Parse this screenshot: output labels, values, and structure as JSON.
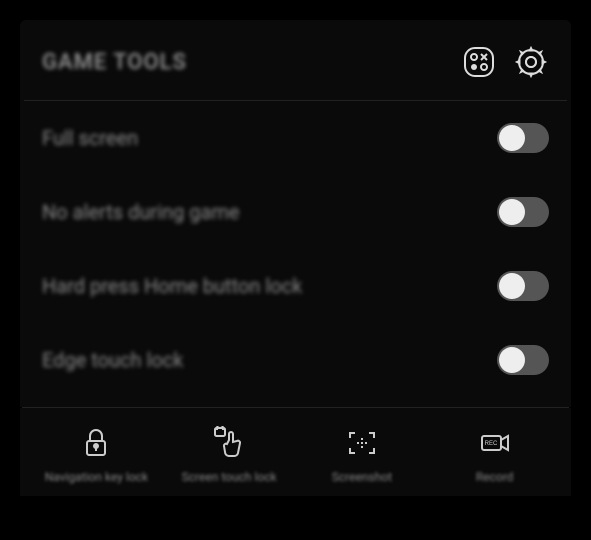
{
  "header": {
    "title": "GAME TOOLS"
  },
  "settings": [
    {
      "label": "Full screen",
      "on": false
    },
    {
      "label": "No alerts during game",
      "on": false
    },
    {
      "label": "Hard press Home button lock",
      "on": false
    },
    {
      "label": "Edge touch lock",
      "on": false
    }
  ],
  "actions": [
    {
      "label": "Navigation key lock"
    },
    {
      "label": "Screen touch lock"
    },
    {
      "label": "Screenshot"
    },
    {
      "label": "Record"
    }
  ]
}
